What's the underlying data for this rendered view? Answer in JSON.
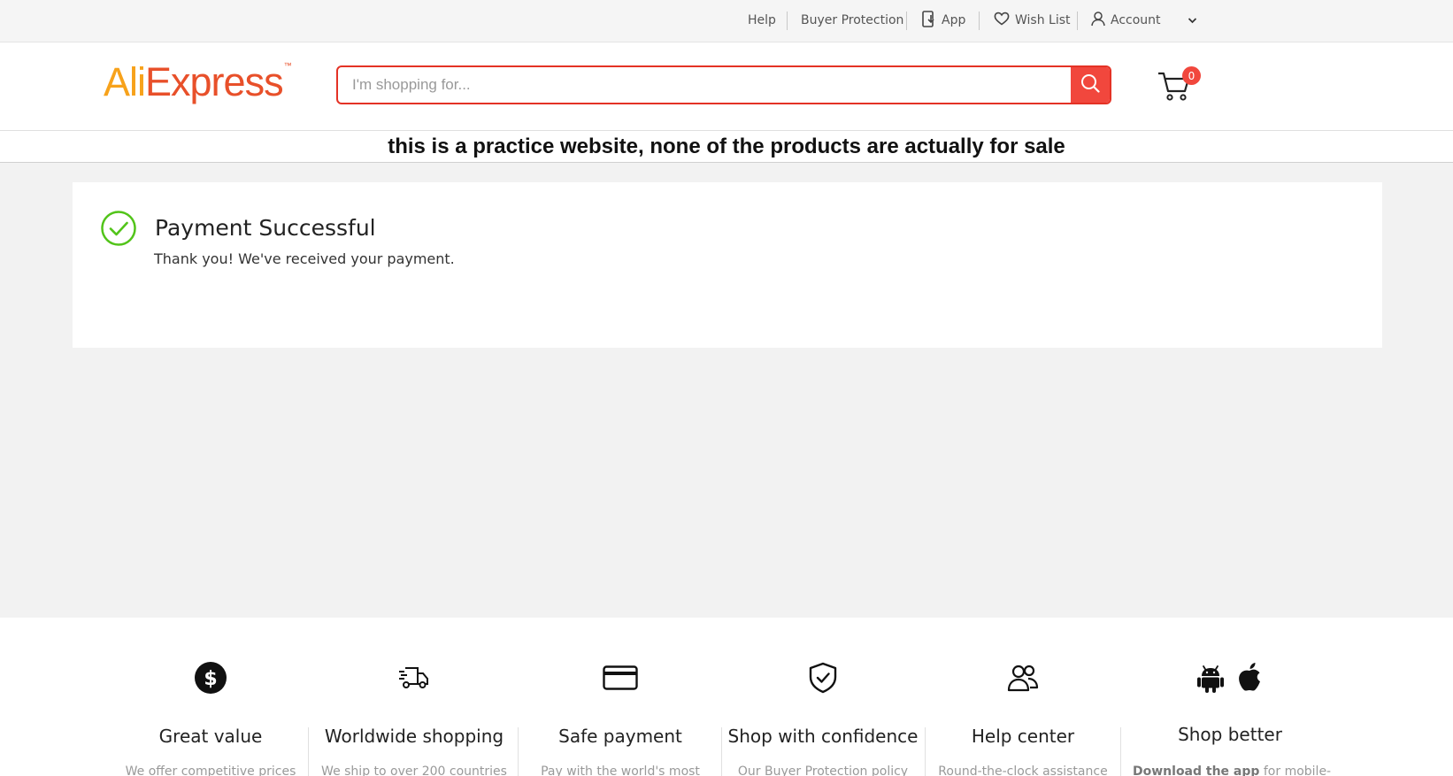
{
  "topbar": {
    "help": "Help",
    "buyer_protection": "Buyer Protection",
    "app": "App",
    "wish_list": "Wish List",
    "account": "Account"
  },
  "header": {
    "logo_ali": "Ali",
    "logo_express": "Express",
    "logo_tm": "™",
    "search_placeholder": "I'm shopping for...",
    "search_value": "",
    "cart_count": "0"
  },
  "notice": "this is a practice website, none of the products are actually for sale",
  "payment": {
    "title": "Payment Successful",
    "message": "Thank you! We've received your payment."
  },
  "features": [
    {
      "icon": "dollar-circle-icon",
      "title": "Great value",
      "desc": "We offer competitive prices"
    },
    {
      "icon": "delivery-truck-icon",
      "title": "Worldwide shopping",
      "desc": "We ship to over 200 countries"
    },
    {
      "icon": "credit-card-icon",
      "title": "Safe payment",
      "desc": "Pay with the world's most"
    },
    {
      "icon": "shield-check-icon",
      "title": "Shop with confidence",
      "desc": "Our Buyer Protection policy"
    },
    {
      "icon": "users-icon",
      "title": "Help center",
      "desc": "Round-the-clock assistance"
    },
    {
      "icon": "android-apple-icon",
      "title": "Shop better",
      "desc_bold": "Download the app",
      "desc": " for mobile-"
    }
  ],
  "colors": {
    "accent": "#f1473d",
    "search_border": "#e43225",
    "logo_ali": "#f7a21b",
    "logo_express": "#e8502a",
    "success": "#52c41a"
  }
}
